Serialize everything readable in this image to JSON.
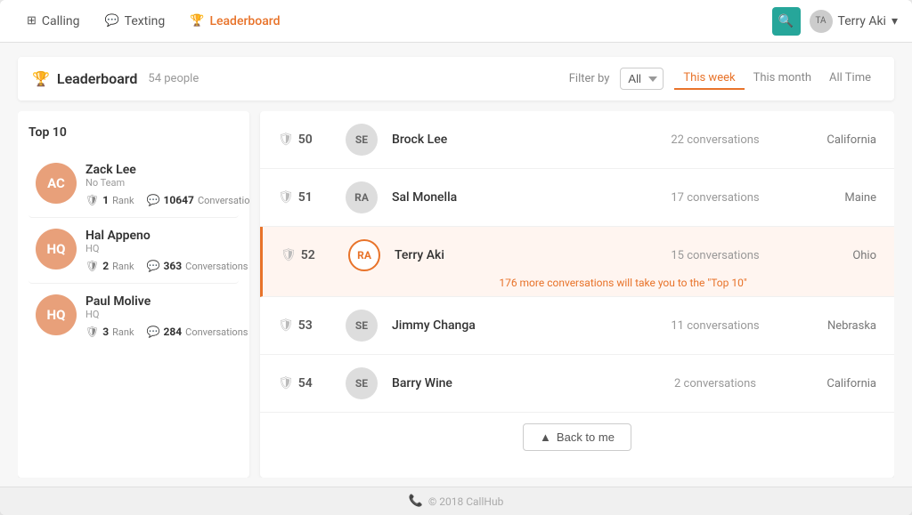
{
  "nav": {
    "calling_label": "Calling",
    "texting_label": "Texting",
    "leaderboard_label": "Leaderboard",
    "user_label": "Terry Aki",
    "user_initials": "TA"
  },
  "leaderboard": {
    "title": "Leaderboard",
    "count": "54 people",
    "filter_label": "Filter by",
    "filter_value": "All",
    "periods": [
      {
        "label": "This week",
        "active": true
      },
      {
        "label": "This month",
        "active": false
      },
      {
        "label": "All Time",
        "active": false
      }
    ],
    "sidebar_title": "Top 10",
    "sidebar_items": [
      {
        "initials": "AC",
        "name": "Zack Lee",
        "team": "No Team",
        "rank": "1",
        "conversations": "10647",
        "bg": "#e8a07a"
      },
      {
        "initials": "HQ",
        "name": "Hal Appeno",
        "team": "HQ",
        "rank": "2",
        "conversations": "363",
        "bg": "#e8a07a"
      },
      {
        "initials": "HQ",
        "name": "Paul Molive",
        "team": "HQ",
        "rank": "3",
        "conversations": "284",
        "bg": "#e8a07a"
      }
    ],
    "table_rows": [
      {
        "rank": "50",
        "initials": "SE",
        "name": "Brock Lee",
        "conversations": "22 conversations",
        "location": "California",
        "highlighted": false,
        "has_msg": false
      },
      {
        "rank": "51",
        "initials": "RA",
        "name": "Sal Monella",
        "conversations": "17 conversations",
        "location": "Maine",
        "highlighted": false,
        "has_msg": false
      },
      {
        "rank": "52",
        "initials": "RA",
        "name": "Terry Aki",
        "conversations": "15 conversations",
        "location": "Ohio",
        "highlighted": true,
        "has_msg": true,
        "msg": "176 more conversations will take you to the \"Top 10\""
      },
      {
        "rank": "53",
        "initials": "SE",
        "name": "Jimmy Changa",
        "conversations": "11 conversations",
        "location": "Nebraska",
        "highlighted": false,
        "has_msg": false
      },
      {
        "rank": "54",
        "initials": "SE",
        "name": "Barry Wine",
        "conversations": "2 conversations",
        "location": "California",
        "highlighted": false,
        "has_msg": false
      }
    ],
    "back_to_me": "Back to me"
  },
  "footer": {
    "text": "© 2018 CallHub"
  }
}
